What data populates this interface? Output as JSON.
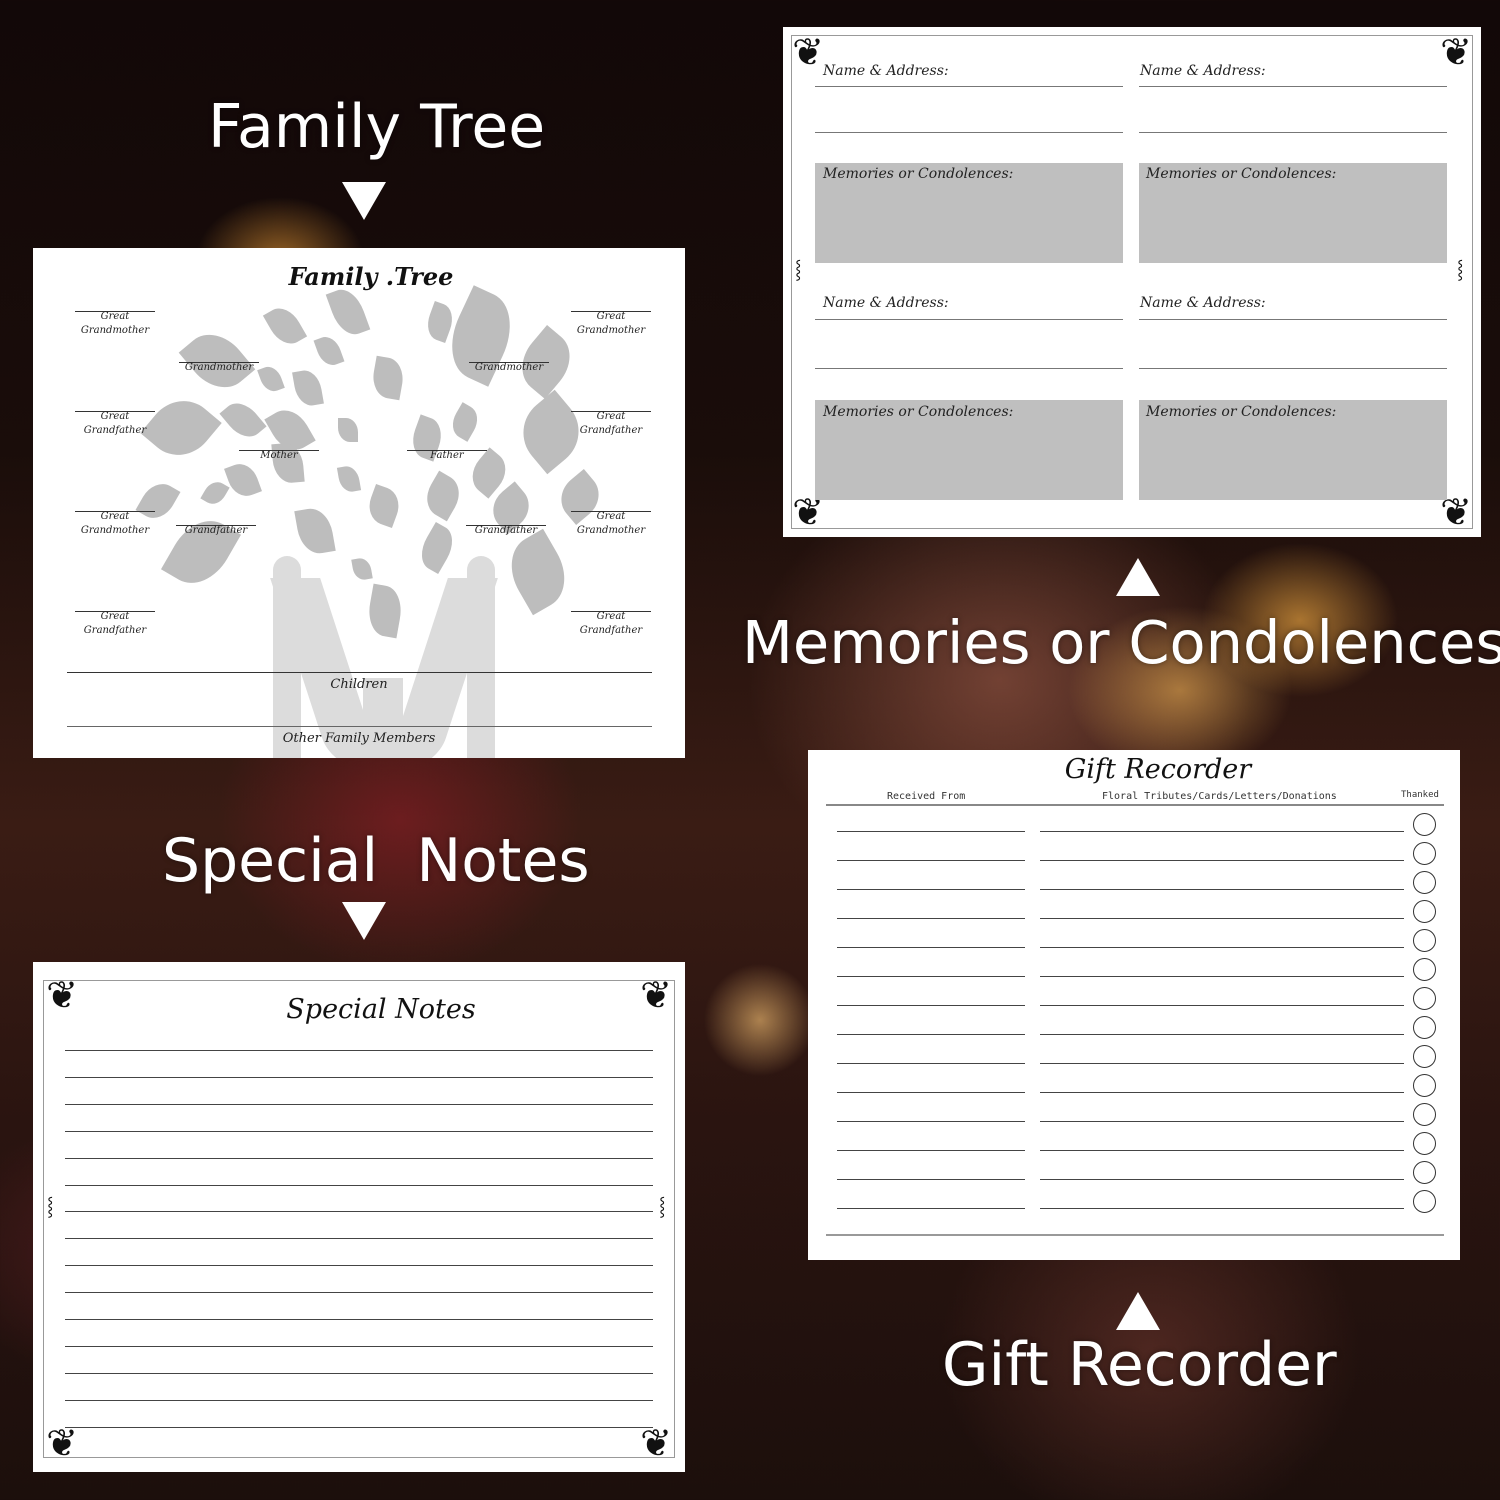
{
  "overlays": {
    "family_tree": "Family Tree",
    "memories": "Memories or Condolences",
    "special_notes": "Special  Notes",
    "gift_recorder": "Gift Recorder"
  },
  "family_tree_page": {
    "title": "Family .Tree",
    "labels": {
      "great_grandmother_tl": [
        "Great",
        "Grandmother"
      ],
      "great_grandmother_tr": [
        "Great",
        "Grandmother"
      ],
      "grandmother_l": "Grandmother",
      "grandmother_r": "Grandmother",
      "great_grandfather_ml": [
        "Great",
        "Grandfather"
      ],
      "great_grandfather_mr": [
        "Great",
        "Grandfather"
      ],
      "mother": "Mother",
      "father": "Father",
      "great_grandmother_bl": [
        "Great",
        "Grandmother"
      ],
      "great_grandmother_br": [
        "Great",
        "Grandmother"
      ],
      "grandfather_l": "Grandfather",
      "grandfather_r": "Grandfather",
      "great_grandfather_bl": [
        "Great",
        "Grandfather"
      ],
      "great_grandfather_br": [
        "Great",
        "Grandfather"
      ],
      "children": "Children",
      "other_family_members": "Other Family Members"
    }
  },
  "memories_page": {
    "name_address_label": "Name & Address:",
    "memories_label": "Memories or Condolences:",
    "entries": 4
  },
  "gift_recorder_page": {
    "title": "Gift Recorder",
    "columns": [
      "Received From",
      "Floral Tributes/Cards/Letters/Donations",
      "Thanked"
    ],
    "row_count": 14
  },
  "special_notes_page": {
    "title": "Special Notes",
    "line_count": 15
  },
  "colors": {
    "memory_box": "#bfbfbf",
    "leaf": "#bdbdbd",
    "overlay_text": "#ffffff"
  }
}
